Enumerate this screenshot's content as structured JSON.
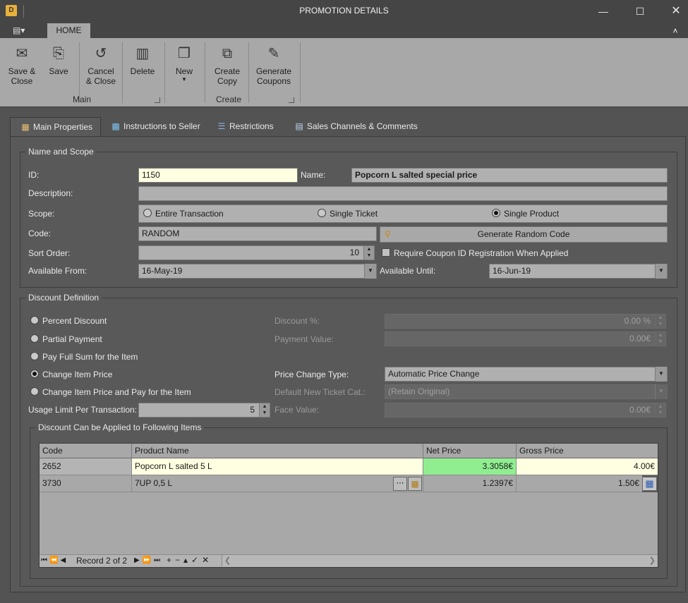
{
  "window": {
    "title": "PROMOTION DETAILS",
    "app_icon": "D"
  },
  "menu": {
    "home_tab": "HOME"
  },
  "ribbon": {
    "buttons": [
      {
        "label": "Save &\nClose",
        "icon": "save-close-icon"
      },
      {
        "label": "Save",
        "icon": "save-icon"
      },
      {
        "label": "Cancel\n& Close",
        "icon": "undo-icon"
      },
      {
        "label": "Delete",
        "icon": "trash-icon"
      },
      {
        "label": "New",
        "icon": "new-doc-icon"
      },
      {
        "label": "Create\nCopy",
        "icon": "copy-icon"
      },
      {
        "label": "Generate\nCoupons",
        "icon": "coupon-icon"
      }
    ],
    "groups": {
      "main": "Main",
      "create": "Create"
    }
  },
  "tabs": [
    "Main Properties",
    "Instructions to Seller",
    "Restrictions",
    "Sales Channels & Comments"
  ],
  "name_scope": {
    "legend": "Name and Scope",
    "id_label": "ID:",
    "id_value": "1150",
    "name_label": "Name:",
    "name_value": "Popcorn L salted special price",
    "description_label": "Description:",
    "description_value": "",
    "scope_label": "Scope:",
    "scope_options": [
      "Entire Transaction",
      "Single Ticket",
      "Single Product"
    ],
    "scope_selected": "Single Product",
    "code_label": "Code:",
    "code_value": "RANDOM",
    "generate_button": "Generate Random Code",
    "sort_label": "Sort Order:",
    "sort_value": "10",
    "coupon_check_label": "Require Coupon ID Registration When Applied",
    "from_label": "Available From:",
    "from_value": "16-May-19",
    "until_label": "Available Until:",
    "until_value": "16-Jun-19"
  },
  "discount": {
    "legend": "Discount Definition",
    "options": [
      "Percent Discount",
      "Partial Payment",
      "Pay Full Sum for the Item",
      "Change Item Price",
      "Change Item Price and Pay for the Item"
    ],
    "selected": "Change Item Price",
    "discount_pct_label": "Discount %:",
    "discount_pct_value": "0.00 %",
    "payment_value_label": "Payment Value:",
    "payment_value": "0.00€",
    "price_change_type_label": "Price Change Type:",
    "price_change_type_value": "Automatic Price Change",
    "default_ticket_label": "Default New Ticket Cat.:",
    "default_ticket_value": "(Retain Original)",
    "usage_limit_label": "Usage Limit Per Transaction:",
    "usage_limit_value": "5",
    "face_value_label": "Face Value:",
    "face_value": "0.00€"
  },
  "items": {
    "legend": "Discount Can be Applied to Following Items",
    "columns": [
      "Code",
      "Product Name",
      "Net Price",
      "Gross Price"
    ],
    "rows": [
      {
        "code": "2652",
        "name": "Popcorn L salted 5 L",
        "net": "3.3058€",
        "gross": "4.00€"
      },
      {
        "code": "3730",
        "name": "7UP 0,5 L",
        "net": "1.2397€",
        "gross": "1.50€"
      }
    ],
    "navigator": "Record 2 of 2"
  },
  "colors": {
    "accent_green": "#90ee90",
    "highlight_yellow": "#ffffe1"
  }
}
